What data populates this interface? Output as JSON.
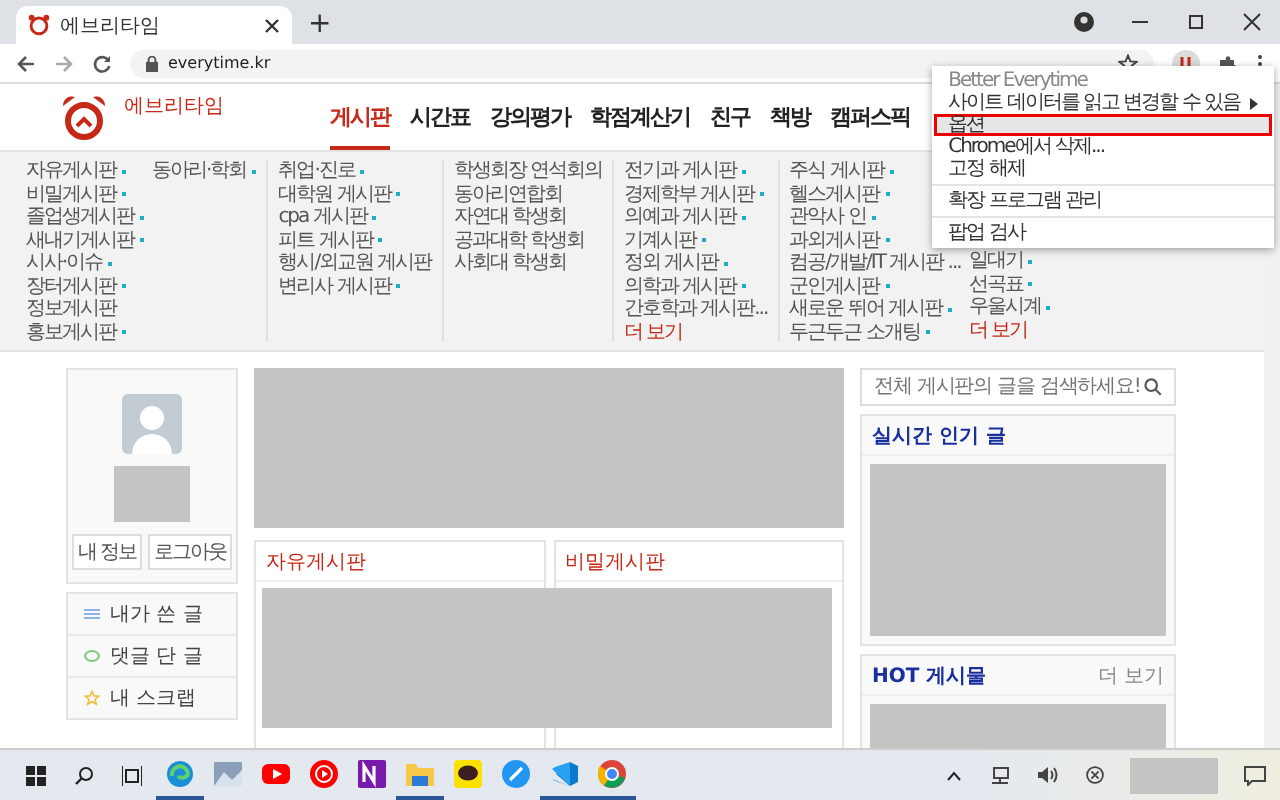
{
  "browser": {
    "tab_title": "에브리타임",
    "new_tab": "+",
    "url": "everytime.kr"
  },
  "context_menu": [
    {
      "kind": "header",
      "label": "Better Everytime"
    },
    {
      "kind": "submenu",
      "label": "사이트 데이터를 읽고 변경할 수 있음",
      "selected": false
    },
    {
      "kind": "item",
      "label": "옵션",
      "selected": true
    },
    {
      "kind": "item",
      "label": "Chrome에서 삭제...",
      "selected": false
    },
    {
      "kind": "item",
      "label": "고정 해제",
      "selected": false
    },
    {
      "kind": "divider"
    },
    {
      "kind": "item",
      "label": "확장 프로그램 관리",
      "selected": false
    },
    {
      "kind": "divider"
    },
    {
      "kind": "item",
      "label": "팝업 검사",
      "selected": false
    }
  ],
  "header": {
    "logo_text": "에브리타임",
    "nav": [
      {
        "label": "게시판",
        "selected": true
      },
      {
        "label": "시간표",
        "selected": false
      },
      {
        "label": "강의평가",
        "selected": false
      },
      {
        "label": "학점계산기",
        "selected": false
      },
      {
        "label": "친구",
        "selected": false
      },
      {
        "label": "책방",
        "selected": false
      },
      {
        "label": "캠퍼스픽",
        "selected": false
      }
    ]
  },
  "board_menu": {
    "groups": [
      {
        "columns": [
          [
            {
              "kind": "board",
              "label": "자유게시판",
              "new": true
            },
            {
              "kind": "board",
              "label": "비밀게시판",
              "new": true
            },
            {
              "kind": "board",
              "label": "졸업생게시판",
              "new": true
            },
            {
              "kind": "board",
              "label": "새내기게시판",
              "new": true
            },
            {
              "kind": "board",
              "label": "시사·이슈",
              "new": true
            },
            {
              "kind": "board",
              "label": "장터게시판",
              "new": true
            },
            {
              "kind": "board",
              "label": "정보게시판",
              "new": false
            },
            {
              "kind": "board",
              "label": "홍보게시판",
              "new": true
            }
          ],
          [
            {
              "kind": "board",
              "label": "동아리·학회",
              "new": true
            }
          ]
        ]
      },
      {
        "columns": [
          [
            {
              "kind": "board",
              "label": "취업·진로",
              "new": true
            },
            {
              "kind": "board",
              "label": "대학원 게시판",
              "new": true
            },
            {
              "kind": "board",
              "label": "cpa 게시판",
              "new": true
            },
            {
              "kind": "board",
              "label": "피트 게시판",
              "new": true
            },
            {
              "kind": "board",
              "label": "행시/외교원 게시판",
              "new": false
            },
            {
              "kind": "board",
              "label": "변리사 게시판",
              "new": true
            }
          ]
        ]
      },
      {
        "columns": [
          [
            {
              "kind": "board",
              "label": "학생회장 연석회의",
              "new": false
            },
            {
              "kind": "board",
              "label": "동아리연합회",
              "new": false
            },
            {
              "kind": "board",
              "label": "자연대 학생회",
              "new": false
            },
            {
              "kind": "board",
              "label": "공과대학 학생회",
              "new": false
            },
            {
              "kind": "board",
              "label": "사회대 학생회",
              "new": false
            }
          ]
        ]
      },
      {
        "columns": [
          [
            {
              "kind": "board",
              "label": "전기과 게시판",
              "new": true
            },
            {
              "kind": "board",
              "label": "경제학부 게시판",
              "new": true
            },
            {
              "kind": "board",
              "label": "의예과 게시판",
              "new": true
            },
            {
              "kind": "board",
              "label": "기계시판",
              "new": true
            },
            {
              "kind": "board",
              "label": "정외 게시판",
              "new": true
            },
            {
              "kind": "board",
              "label": "의학과 게시판",
              "new": true
            },
            {
              "kind": "board",
              "label": "간호학과 게시판...",
              "new": false
            },
            {
              "kind": "more",
              "label": "더 보기"
            }
          ]
        ]
      },
      {
        "columns": [
          [
            {
              "kind": "board",
              "label": "주식 게시판",
              "new": true
            },
            {
              "kind": "board",
              "label": "헬스게시판",
              "new": true
            },
            {
              "kind": "board",
              "label": "관악사 인",
              "new": true
            },
            {
              "kind": "board",
              "label": "과외게시판",
              "new": true
            },
            {
              "kind": "board",
              "label": "컴공/개발/IT 게시판 ...",
              "new": false
            },
            {
              "kind": "board",
              "label": "군인게시판",
              "new": true
            },
            {
              "kind": "board",
              "label": "새로운 뛰어 게시판",
              "new": true
            },
            {
              "kind": "board",
              "label": "두근두근 소개팅",
              "new": true
            }
          ],
          [
            {
              "kind": "board",
              "label": "일대기",
              "new": true
            },
            {
              "kind": "board",
              "label": "선곡표",
              "new": true
            },
            {
              "kind": "board",
              "label": "우울시계",
              "new": true
            },
            {
              "kind": "more",
              "label": "더 보기"
            }
          ]
        ]
      }
    ]
  },
  "profile": {
    "buttons": [
      "내 정보",
      "로그아웃"
    ]
  },
  "my_menu": [
    {
      "label": "내가 쓴 글"
    },
    {
      "label": "댓글 단 글"
    },
    {
      "label": "내 스크랩"
    }
  ],
  "boards": [
    {
      "title": "자유게시판"
    },
    {
      "title": "비밀게시판"
    }
  ],
  "search": {
    "placeholder": "전체 게시판의 글을 검색하세요!"
  },
  "side_cards": [
    {
      "title": "실시간 인기 글"
    },
    {
      "title": "HOT 게시물",
      "more": "더 보기"
    }
  ],
  "taskbar_apps": [
    {
      "running": true
    },
    {
      "running": false
    },
    {
      "running": false
    },
    {
      "running": false
    },
    {
      "running": false
    },
    {
      "running": true
    },
    {
      "running": false
    },
    {
      "running": false
    },
    {
      "running": true
    },
    {
      "running": true
    }
  ]
}
